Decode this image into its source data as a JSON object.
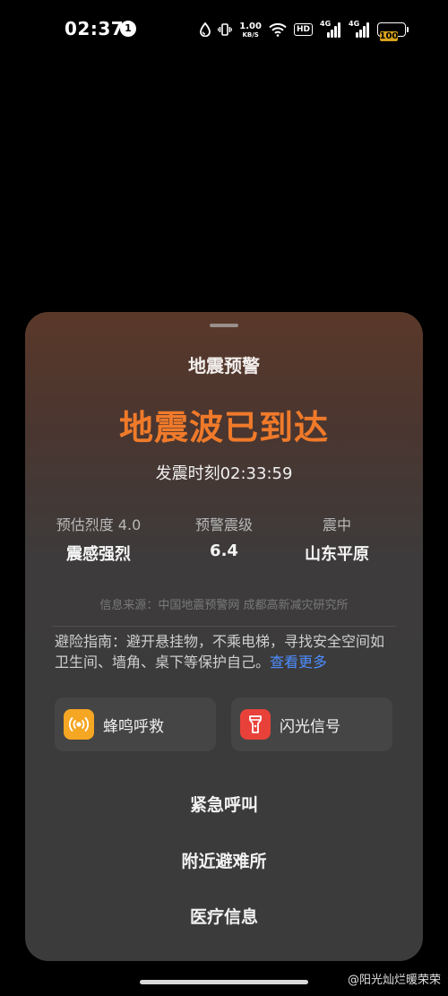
{
  "status_bar": {
    "time": "02:37",
    "notification_count": "1",
    "net_speed_value": "1.00",
    "net_speed_unit": "KB/S",
    "hd_label": "HD",
    "signal1_label": "4G",
    "signal2_label": "4G",
    "battery_level": "100",
    "battery_color": "#d8a21c"
  },
  "alert": {
    "title": "地震预警",
    "headline": "地震波已到达",
    "quake_time": "发震时刻02:33:59",
    "stats": [
      {
        "label": "预估烈度 4.0",
        "value": "震感强烈"
      },
      {
        "label": "预警震级",
        "value": "6.4"
      },
      {
        "label": "震中",
        "value": "山东平原"
      }
    ],
    "source": "信息来源：中国地震预警网 成都高新减灾研究所",
    "guide_text": "避险指南：避开悬挂物，不乘电梯，寻找安全空间如卫生间、墙角、桌下等保护自己。",
    "guide_more": "查看更多",
    "actions": [
      {
        "label": "蜂鸣呼救",
        "icon": "alarm-icon",
        "color": "#f5a623"
      },
      {
        "label": "闪光信号",
        "icon": "flashlight-icon",
        "color": "#e8413a"
      }
    ],
    "menu": [
      {
        "label": "紧急呼叫"
      },
      {
        "label": "附近避难所"
      },
      {
        "label": "医疗信息"
      }
    ],
    "headline_color": "#f07a2a",
    "link_color": "#4c8dff"
  },
  "watermark": "@阳光灿烂暖荣荣"
}
